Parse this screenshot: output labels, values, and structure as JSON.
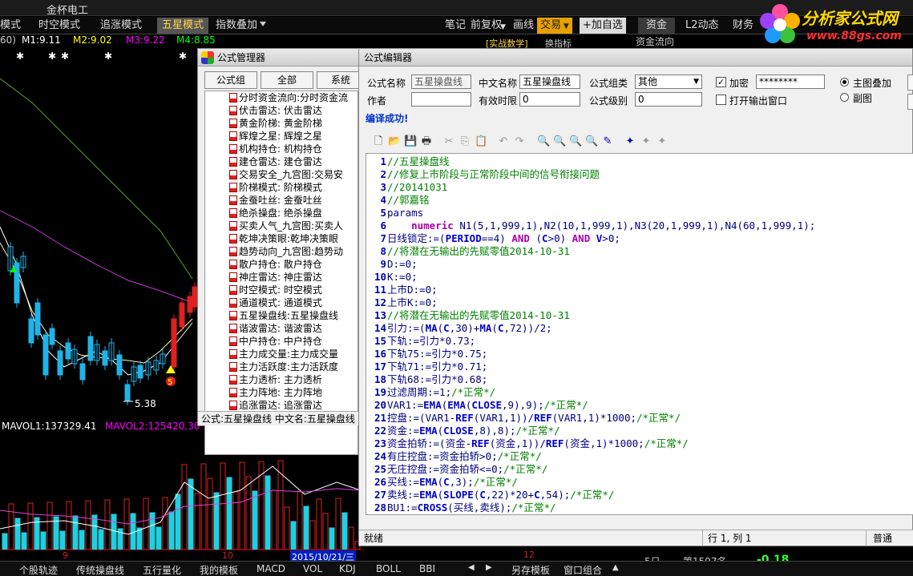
{
  "app": {
    "title": "金杯电工"
  },
  "mode_tabs": [
    "模式",
    "时空模式",
    "追涨模式",
    "五星模式",
    "指数叠加"
  ],
  "toolbar_right": {
    "notes": "笔记",
    "adjust": "前复权",
    "draw": "画线",
    "trade": "交易",
    "add_watch": "加自选",
    "fund": "资金",
    "l2": "L2动态",
    "finance": "财务"
  },
  "sub_labels": {
    "fund_flow": "资金流向",
    "real_math": "[实战数学]",
    "indicator": "换指标"
  },
  "logo": {
    "title": "分析家公式网",
    "url": "www.88gs.com"
  },
  "chart": {
    "info": {
      "period": "60)",
      "m1": "M1:9.11",
      "m2": "M2:9.02",
      "m3": "M3:9.22",
      "m4": "M4:8.85"
    },
    "low_label": "5.38",
    "signal_label": "5",
    "mavol1": "MAVOL1:137329.41",
    "mavol2": "MAVOL2:125420.30",
    "date_labels": [
      "9",
      "10",
      "12"
    ],
    "cursor_date": "2015/10/21/三"
  },
  "bottom_tabs": [
    "个股轨迹",
    "传统操盘线",
    "五行量化",
    "我的模板",
    "MACD",
    "VOL",
    "KDJ",
    "BOLL",
    "BBI",
    "另存模板",
    "窗口组合"
  ],
  "bottom_right": {
    "day": "5日",
    "rank": "第1597名",
    "value": "-0.18"
  },
  "manager": {
    "title": "公式管理器",
    "tabs": [
      "公式组",
      "全部",
      "系统"
    ],
    "items": [
      "分时资金流向:分时资金流",
      "伏击雷达: 伏击雷达",
      "黄金阶梯: 黄金阶梯",
      "辉煌之星: 辉煌之星",
      "机构持仓: 机构持仓",
      "建仓雷达: 建仓雷达",
      "交易安全_九宫图:交易安",
      "阶梯模式: 阶梯模式",
      "金蚕吐丝: 金蚕吐丝",
      "绝杀操盘: 绝杀操盘",
      "买卖人气_九宫图:买卖人",
      "乾坤决策眼:乾坤决策眼",
      "趋势动向_九宫图:趋势动",
      "散户持仓: 散户持仓",
      "神庄雷达: 神庄雷达",
      "时空模式: 时空模式",
      "通道模式: 通道模式",
      "五星操盘线:五星操盘线",
      "谐波雷达: 谐波雷达",
      "中户持仓: 中户持仓",
      "主力成交量:主力成交量",
      "主力活跃度:主力活跃度",
      "主力透析: 主力透析",
      "主力阵地: 主力阵地",
      "追涨雷达: 追涨雷达"
    ],
    "status": "公式:五星操盘线  中文名:五星操盘线"
  },
  "editor": {
    "title": "公式编辑器",
    "name_label": "公式名称",
    "name_value": "五星操盘线",
    "cn_name_label": "中文名称",
    "cn_name_value": "五星操盘线",
    "group_label": "公式组类",
    "group_value": "其他",
    "encrypt_label": "加密",
    "password_value": "********",
    "main_overlay_label": "主图叠加",
    "author_label": "作者",
    "author_value": "",
    "valid_label": "有效时限",
    "valid_value": "0",
    "level_label": "公式级别",
    "level_value": "0",
    "output_window_label": "打开输出窗口",
    "sub_chart_label": "副图",
    "compile_msg": "编译成功!",
    "status_ready": "就绪",
    "status_pos": "行 1, 列 1",
    "status_mode": "普通"
  }
}
